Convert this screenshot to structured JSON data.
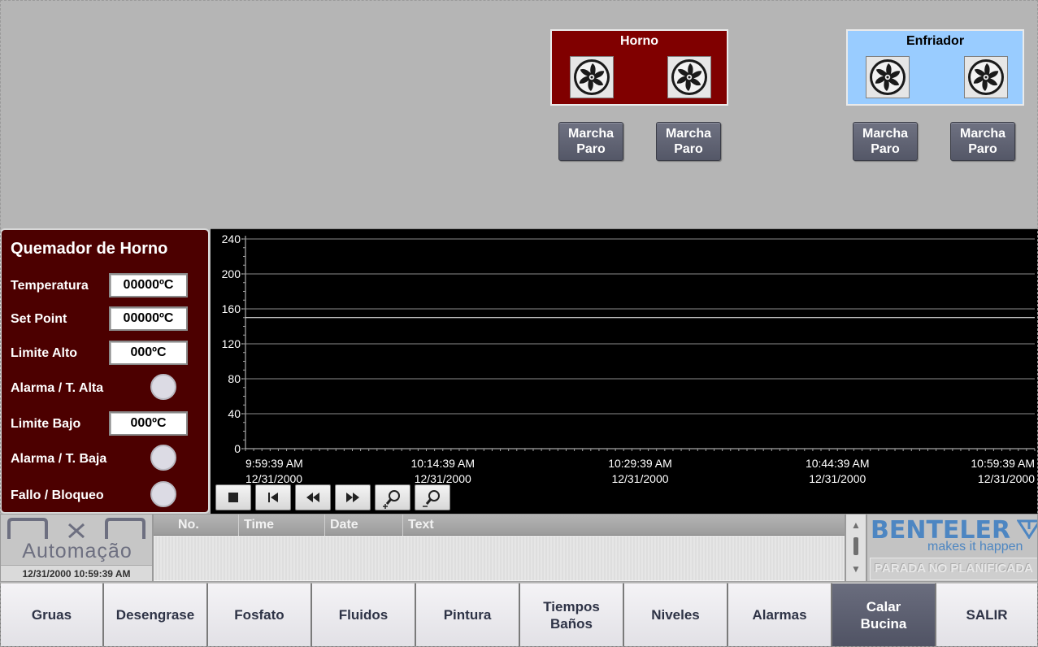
{
  "equipment": {
    "horno": {
      "title": "Horno",
      "color": "#800000"
    },
    "enfriador": {
      "title": "Enfriador",
      "color": "#99ccff"
    },
    "fan_icon": "fan-icon",
    "buttons": [
      {
        "line1": "Marcha",
        "line2": "Paro"
      },
      {
        "line1": "Marcha",
        "line2": "Paro"
      },
      {
        "line1": "Marcha",
        "line2": "Paro"
      },
      {
        "line1": "Marcha",
        "line2": "Paro"
      }
    ]
  },
  "burner": {
    "title": "Quemador de Horno",
    "temperatura_label": "Temperatura",
    "temperatura_value": "00000ºC",
    "setpoint_label": "Set Point",
    "setpoint_value": "00000ºC",
    "limite_alto_label": "Limite Alto",
    "limite_alto_value": "000ºC",
    "alarma_alta_label": "Alarma / T. Alta",
    "limite_bajo_label": "Limite Bajo",
    "limite_bajo_value": "000ºC",
    "alarma_baja_label": "Alarma / T. Baja",
    "fallo_label": "Fallo / Bloqueo"
  },
  "chart_data": {
    "type": "line",
    "ylim": [
      0,
      240
    ],
    "yticks": [
      "240",
      "200",
      "160",
      "120",
      "80",
      "40",
      "0"
    ],
    "xticks": [
      {
        "time": "9:59:39 AM",
        "date": "12/31/2000"
      },
      {
        "time": "10:14:39 AM",
        "date": "12/31/2000"
      },
      {
        "time": "10:29:39 AM",
        "date": "12/31/2000"
      },
      {
        "time": "10:44:39 AM",
        "date": "12/31/2000"
      },
      {
        "time": "10:59:39 AM",
        "date": "12/31/2000"
      }
    ],
    "series": [
      {
        "values": [
          150,
          150,
          150,
          150,
          150
        ],
        "color": "#ffffff"
      }
    ],
    "grid": true,
    "background": "#000000"
  },
  "trend_controls": [
    "stop-icon",
    "first-icon",
    "rewind-icon",
    "forward-icon",
    "zoom-in-icon",
    "zoom-out-icon"
  ],
  "logo": {
    "text": "Automação",
    "datetime": "12/31/2000 10:59:39 AM"
  },
  "alarms": {
    "columns": [
      "No.",
      "Time",
      "Date",
      "Text"
    ]
  },
  "brand": {
    "name": "BENTELER",
    "tagline": "makes it happen",
    "status": "PARADA NO PLANIFICADA"
  },
  "nav": [
    {
      "label": "Gruas"
    },
    {
      "label": "Desengrase"
    },
    {
      "label": "Fosfato"
    },
    {
      "label": "Fluidos"
    },
    {
      "label": "Pintura"
    },
    {
      "label": "Tiempos\nBaños"
    },
    {
      "label": "Niveles"
    },
    {
      "label": "Alarmas"
    },
    {
      "label": "Calar\nBucina",
      "active": true
    },
    {
      "label": "SALIR"
    }
  ]
}
